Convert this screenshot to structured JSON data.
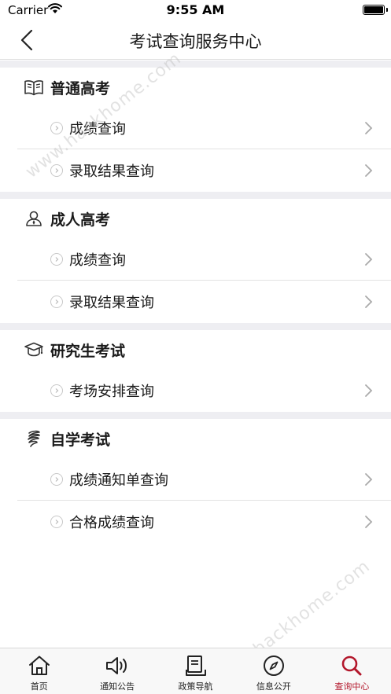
{
  "status_bar": {
    "carrier": "Carrier",
    "time": "9:55 AM"
  },
  "nav": {
    "title": "考试查询服务中心"
  },
  "sections": [
    {
      "title": "普通高考",
      "icon": "book-icon",
      "items": [
        "成绩查询",
        "录取结果查询"
      ]
    },
    {
      "title": "成人高考",
      "icon": "person-icon",
      "items": [
        "成绩查询",
        "录取结果查询"
      ]
    },
    {
      "title": "研究生考试",
      "icon": "graduation-cap-icon",
      "items": [
        "考场安排查询"
      ]
    },
    {
      "title": "自学考试",
      "icon": "spiral-icon",
      "items": [
        "成绩通知单查询",
        "合格成绩查询"
      ]
    }
  ],
  "watermark": {
    "text": "www.hackhome.com"
  },
  "tabs": [
    {
      "label": "首页",
      "icon": "home-icon",
      "active": false
    },
    {
      "label": "通知公告",
      "icon": "speaker-icon",
      "active": false
    },
    {
      "label": "政策导航",
      "icon": "document-icon",
      "active": false
    },
    {
      "label": "信息公开",
      "icon": "compass-icon",
      "active": false
    },
    {
      "label": "查询中心",
      "icon": "search-icon",
      "active": true
    }
  ],
  "colors": {
    "accent": "#b3172b",
    "divider_band": "#eeeef2"
  }
}
